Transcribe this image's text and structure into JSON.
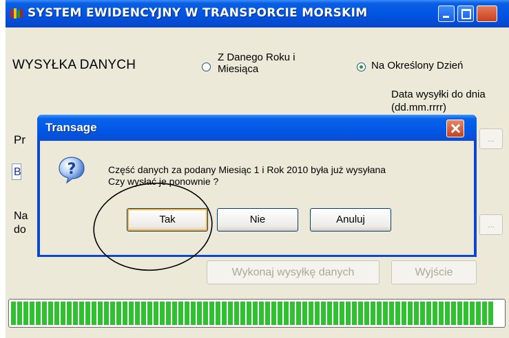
{
  "main_window": {
    "title": "SYSTEM EWIDENCYJNY W TRANSPORCIE MORSKIM",
    "section_title": "WYSYŁKA DANYCH",
    "radio_options": [
      {
        "label": "Z Danego Roku i Miesiąca",
        "checked": false
      },
      {
        "label": "Na Określony Dzień",
        "checked": true
      }
    ],
    "date_label": "Data wysyłki do dnia (dd.mm.rrrr)",
    "partial_labels": {
      "pr": "Pr",
      "b": "B",
      "na": "Na",
      "do": "do"
    },
    "browse_button_label": "...",
    "execute_button_label": "Wykonaj wysyłkę danych",
    "exit_button_label": "Wyjście",
    "progress_value": 0.98,
    "colors": {
      "title_bar": "#0054E3",
      "progress": "#2FC12F",
      "window_bg": "#ECE9D8"
    }
  },
  "dialog": {
    "title": "Transage",
    "icon": "question-icon",
    "message_line1": "Część danych za podany Miesiąc  1 i Rok 2010 była już wysyłana",
    "message_line2": "Czy wysłać je ponownie ?",
    "buttons": {
      "yes": "Tak",
      "no": "Nie",
      "cancel": "Anuluj"
    }
  }
}
